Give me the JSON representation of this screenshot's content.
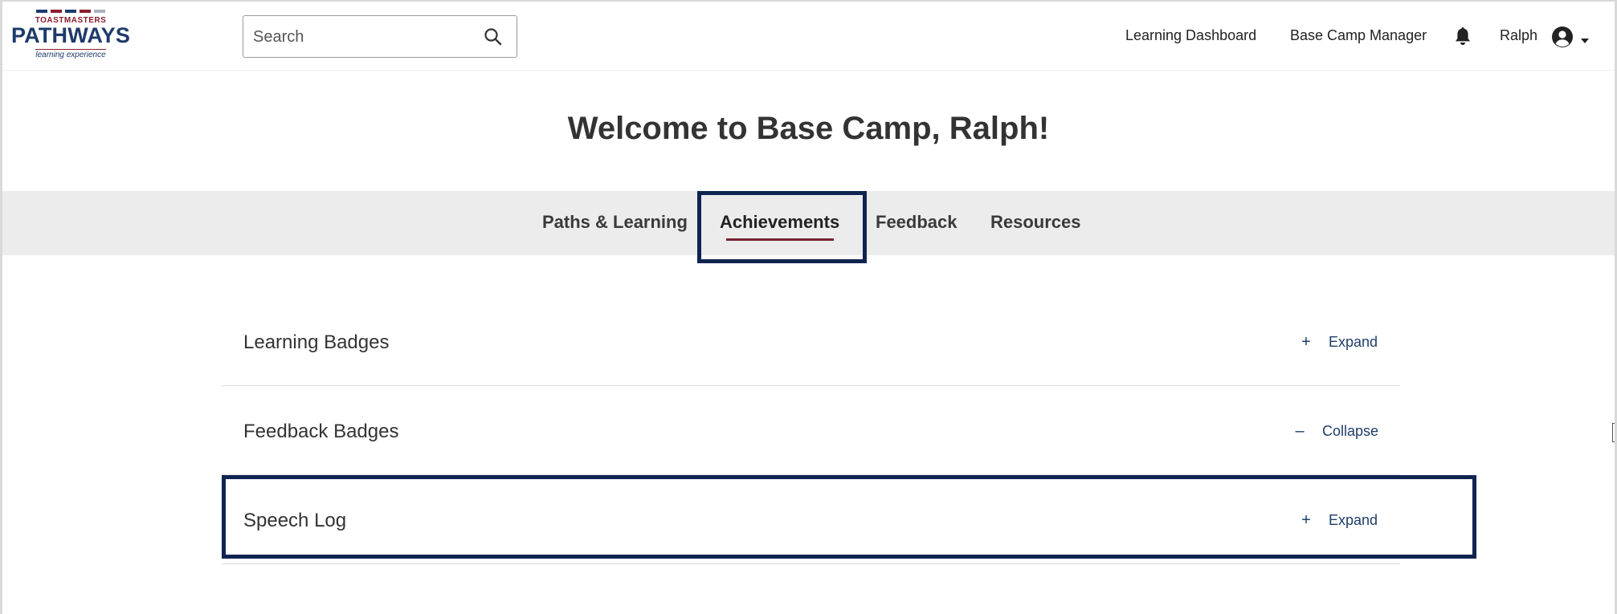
{
  "header": {
    "logo": {
      "top_text": "TOASTMASTERS",
      "main_text": "PATHWAYS",
      "sub_text": "learning experience"
    },
    "search": {
      "placeholder": "Search",
      "icon": "search-icon"
    },
    "nav": {
      "learning_dashboard": "Learning Dashboard",
      "base_camp_manager": "Base Camp Manager"
    },
    "notifications_icon": "bell-icon",
    "user": {
      "name": "Ralph",
      "icon": "user-circle-icon",
      "caret_icon": "caret-down-icon"
    }
  },
  "welcome": "Welcome to Base Camp, Ralph!",
  "tabs": [
    {
      "label": "Paths & Learning",
      "active": false
    },
    {
      "label": "Achievements",
      "active": true
    },
    {
      "label": "Feedback",
      "active": false
    },
    {
      "label": "Resources",
      "active": false
    }
  ],
  "sections": [
    {
      "title": "Learning Badges",
      "toggle_symbol": "+",
      "toggle_label": "Expand"
    },
    {
      "title": "Feedback Badges",
      "toggle_symbol": "–",
      "toggle_label": "Collapse"
    },
    {
      "title": "Speech Log",
      "toggle_symbol": "+",
      "toggle_label": "Expand"
    }
  ],
  "colors": {
    "brand_navy": "#1d3b6a",
    "brand_maroon": "#8a1e2e",
    "tab_underline": "#7a2232",
    "highlight_border": "#0f2451",
    "link_blue": "#1f3e6b",
    "tab_bar_bg": "#ececec"
  }
}
